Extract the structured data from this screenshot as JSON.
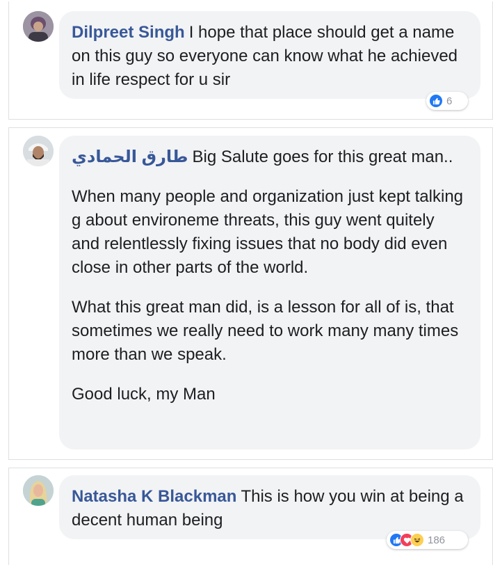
{
  "comments": [
    {
      "author": "Dilpreet Singh",
      "text": "I hope that place should get a name on this guy so everyone can know what he achieved in life respect for u sir",
      "reaction_count": "6",
      "reactions": [
        "like"
      ]
    },
    {
      "author": "طارق الحمادي",
      "paragraphs": [
        "Big Salute goes for this great man..",
        "When many people and organization just kept talking g about environeme threats, this guy went quitely and relentlessly fixing issues that no body did even close in other parts of the world.",
        "What this great man did, is a lesson for all of is, that sometimes we really need to work many many times more than we speak.",
        "Good luck, my Man"
      ]
    },
    {
      "author": "Natasha K Blackman",
      "text": "This is how you win at being a decent human being",
      "reaction_count": "186",
      "reactions": [
        "like",
        "love",
        "haha"
      ]
    }
  ],
  "colors": {
    "author_link": "#385898",
    "bubble_bg": "#f2f3f5",
    "like_blue": "#2078f4",
    "love_red": "#f33e58",
    "haha_yellow": "#fcd053"
  }
}
